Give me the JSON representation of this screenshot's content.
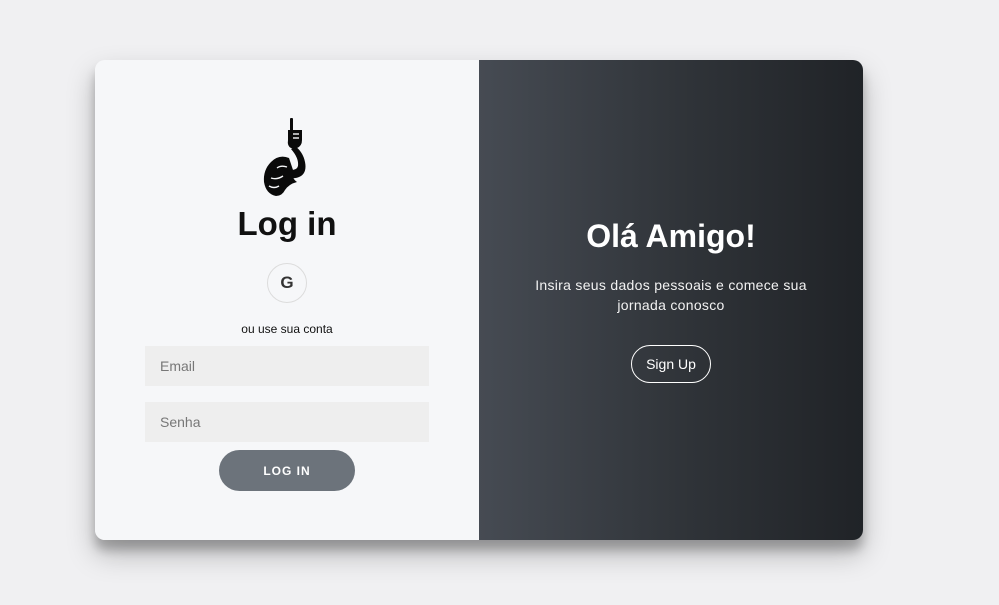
{
  "login_panel": {
    "title": "Log in",
    "google_icon_glyph": "G",
    "alt_text": "ou use sua conta",
    "email_placeholder": "Email",
    "password_placeholder": "Senha",
    "login_label": "LOG IN"
  },
  "signup_panel": {
    "heading": "Olá Amigo!",
    "description": "Insira seus dados pessoais e comece sua jornada conosco",
    "signup_label": "Sign Up"
  },
  "colors": {
    "page_bg": "#f0f0f2",
    "left_bg": "#f6f7f9",
    "right_gradient_start": "#464b53",
    "right_gradient_end": "#202327",
    "login_button": "#6c737b"
  },
  "icons": {
    "logo": "flexed-arm-icon",
    "google": "google-icon"
  }
}
